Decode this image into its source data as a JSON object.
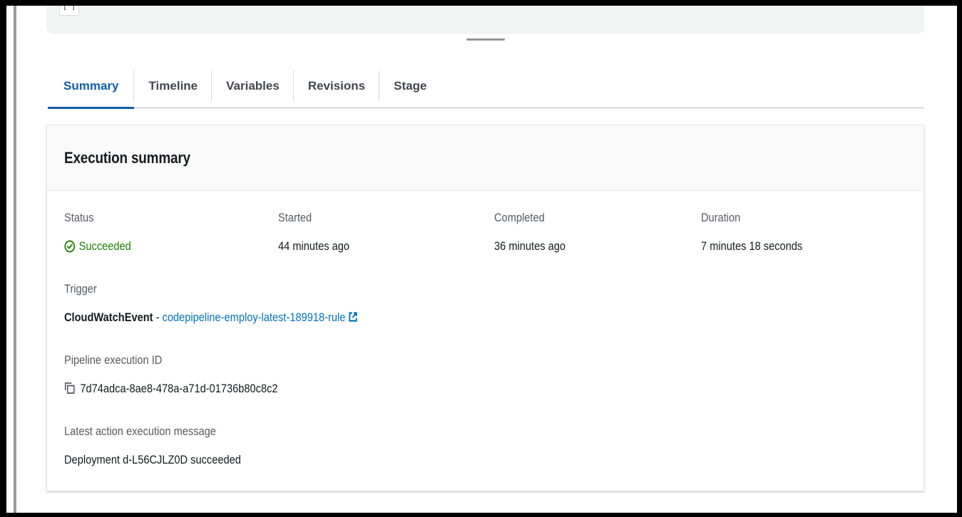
{
  "tabs": [
    {
      "label": "Summary",
      "active": true
    },
    {
      "label": "Timeline",
      "active": false
    },
    {
      "label": "Variables",
      "active": false
    },
    {
      "label": "Revisions",
      "active": false
    },
    {
      "label": "Stage",
      "active": false
    }
  ],
  "card": {
    "title": "Execution summary",
    "status": {
      "label": "Status",
      "value": "Succeeded",
      "icon": "check-circle-icon",
      "color": "#1d8102"
    },
    "started": {
      "label": "Started",
      "value": "44 minutes ago"
    },
    "completed": {
      "label": "Completed",
      "value": "36 minutes ago"
    },
    "duration": {
      "label": "Duration",
      "value": "7 minutes 18 seconds"
    },
    "trigger": {
      "label": "Trigger",
      "source": "CloudWatchEvent",
      "separator": " - ",
      "rule_link": "codepipeline-employ-latest-189918-rule",
      "link_icon": "external-link-icon"
    },
    "execution_id": {
      "label": "Pipeline execution ID",
      "value": "7d74adca-8ae8-478a-a71d-01736b80c8c2",
      "icon": "copy-icon"
    },
    "message": {
      "label": "Latest action execution message",
      "value": "Deployment d-L56CJLZ0D succeeded"
    }
  },
  "colors": {
    "accent": "#0073bb",
    "active_tab": "#0f5ea8",
    "success": "#1d8102"
  }
}
